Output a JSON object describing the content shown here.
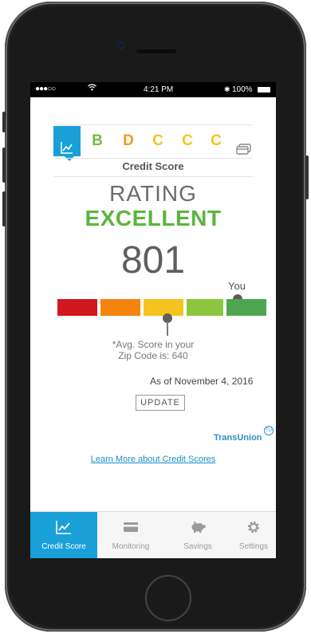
{
  "status_bar": {
    "signal": "●●●○○",
    "time": "4:21 PM",
    "battery": "100%"
  },
  "grade_tabs": [
    {
      "label": "",
      "icon": "line-chart-icon",
      "active": true,
      "color": "#ffffff"
    },
    {
      "label": "B",
      "color": "#6cbf3c"
    },
    {
      "label": "D",
      "color": "#f39a1e"
    },
    {
      "label": "C",
      "color": "#f5c518"
    },
    {
      "label": "C",
      "color": "#f5c518"
    },
    {
      "label": "C",
      "color": "#f5c518"
    },
    {
      "label": "",
      "icon": "cards-icon",
      "color": "#888888"
    }
  ],
  "credit": {
    "title": "Credit Score",
    "rating_label": "RATING",
    "rating_value": "EXCELLENT",
    "score": "801",
    "you_label": "You",
    "avg_line1": "*Avg. Score in your",
    "avg_line2": "Zip Code is: 640",
    "as_of": "As of November 4, 2016",
    "update_label": "UPDATE",
    "provider": "TransUnion",
    "provider_badge": "TU",
    "learn_more": "Learn More about Credit Scores"
  },
  "score_scale_colors": [
    "#d0181e",
    "#f5840f",
    "#f6c21f",
    "#8cc63f",
    "#4fa651"
  ],
  "nav": [
    {
      "label": "Credit Score",
      "icon": "chart-icon",
      "active": true
    },
    {
      "label": "Monitoring",
      "icon": "card-icon",
      "active": false
    },
    {
      "label": "Savings",
      "icon": "piggy-bank-icon",
      "active": false
    },
    {
      "label": "Settings",
      "icon": "gear-icon",
      "active": false
    }
  ],
  "colors": {
    "accent": "#1aa0d8",
    "excellent_green": "#5cb440"
  }
}
